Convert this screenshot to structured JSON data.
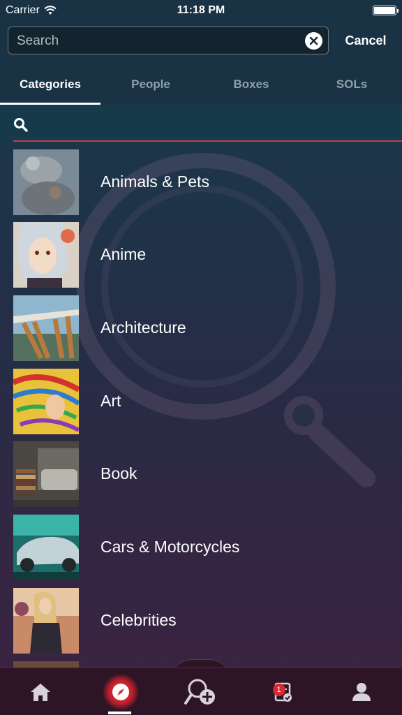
{
  "status_bar": {
    "carrier": "Carrier",
    "time": "11:18 PM"
  },
  "search": {
    "placeholder": "Search",
    "value": "",
    "cancel_label": "Cancel"
  },
  "tabs": [
    {
      "label": "Categories",
      "active": true
    },
    {
      "label": "People",
      "active": false
    },
    {
      "label": "Boxes",
      "active": false
    },
    {
      "label": "SOLs",
      "active": false
    }
  ],
  "categories": [
    {
      "label": "Animals & Pets"
    },
    {
      "label": "Anime"
    },
    {
      "label": "Architecture"
    },
    {
      "label": "Art"
    },
    {
      "label": "Book"
    },
    {
      "label": "Cars & Motorcycles"
    },
    {
      "label": "Celebrities"
    }
  ],
  "tab_bar": {
    "items": [
      "home-icon",
      "explore-icon",
      "search-add-icon",
      "inbox-icon",
      "profile-icon"
    ],
    "notification_badge": "1"
  },
  "colors": {
    "accent_red": "#d52a34",
    "top_bar": "#1a3344",
    "filter_underline": "#b8404a"
  }
}
